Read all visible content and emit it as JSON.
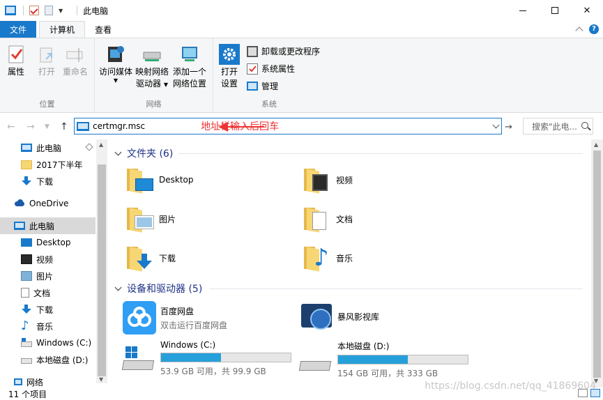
{
  "titlebar": {
    "title": "此电脑",
    "minimize": "minimize",
    "maximize": "maximize",
    "close": "✕"
  },
  "tabs": {
    "file": "文件",
    "computer": "计算机",
    "view": "查看"
  },
  "ribbon": {
    "location": {
      "label": "位置",
      "properties": "属性",
      "open": "打开",
      "rename": "重命名"
    },
    "network": {
      "label": "网络",
      "access_media": "访问媒体",
      "map_drive_1": "映射网络",
      "map_drive_2": "驱动器",
      "add_location_1": "添加一个",
      "add_location_2": "网络位置"
    },
    "system": {
      "label": "系统",
      "open_settings_1": "打开",
      "open_settings_2": "设置",
      "uninstall": "卸载或更改程序",
      "sys_props": "系统属性",
      "manage": "管理"
    }
  },
  "address": {
    "value": "certmgr.msc",
    "annotation": "地址栏输入后回车",
    "search_placeholder": "搜索\"此电..."
  },
  "navpane": {
    "items": [
      {
        "label": "此电脑",
        "icon": "pc-icon"
      },
      {
        "label": "2017下半年",
        "icon": "folder-icon"
      },
      {
        "label": "下载",
        "icon": "download-icon"
      },
      {
        "label": "OneDrive",
        "icon": "cloud-icon"
      },
      {
        "label": "此电脑",
        "icon": "pc-icon"
      },
      {
        "label": "Desktop",
        "icon": "desktop-icon"
      },
      {
        "label": "视频",
        "icon": "video-icon"
      },
      {
        "label": "图片",
        "icon": "picture-icon"
      },
      {
        "label": "文档",
        "icon": "document-icon"
      },
      {
        "label": "下载",
        "icon": "download-icon"
      },
      {
        "label": "音乐",
        "icon": "music-icon"
      },
      {
        "label": "Windows (C:)",
        "icon": "windows-drive-icon"
      },
      {
        "label": "本地磁盘 (D:)",
        "icon": "drive-icon"
      },
      {
        "label": "网络",
        "icon": "network-icon"
      }
    ]
  },
  "folders": {
    "header": "文件夹 (6)",
    "items": [
      {
        "label": "Desktop",
        "icon": "desktop-folder-icon"
      },
      {
        "label": "视频",
        "icon": "video-folder-icon"
      },
      {
        "label": "图片",
        "icon": "picture-folder-icon"
      },
      {
        "label": "文档",
        "icon": "document-folder-icon"
      },
      {
        "label": "下载",
        "icon": "download-folder-icon"
      },
      {
        "label": "音乐",
        "icon": "music-folder-icon"
      }
    ]
  },
  "devices": {
    "header": "设备和驱动器 (5)",
    "baidu": {
      "name": "百度网盘",
      "sub": "双击运行百度网盘"
    },
    "storm": {
      "name": "暴风影视库"
    },
    "c_drive": {
      "name": "Windows (C:)",
      "sub": "53.9 GB 可用，共 99.9 GB",
      "used_fraction": 0.46
    },
    "d_drive": {
      "name": "本地磁盘 (D:)",
      "sub": "154 GB 可用，共 333 GB",
      "used_fraction": 0.54
    }
  },
  "status": {
    "count": "11 个项目"
  },
  "watermark": "https://blog.csdn.net/qq_41869604",
  "colors": {
    "accent": "#1979ca",
    "annotation": "#e33333",
    "bar": "#26a0da"
  }
}
